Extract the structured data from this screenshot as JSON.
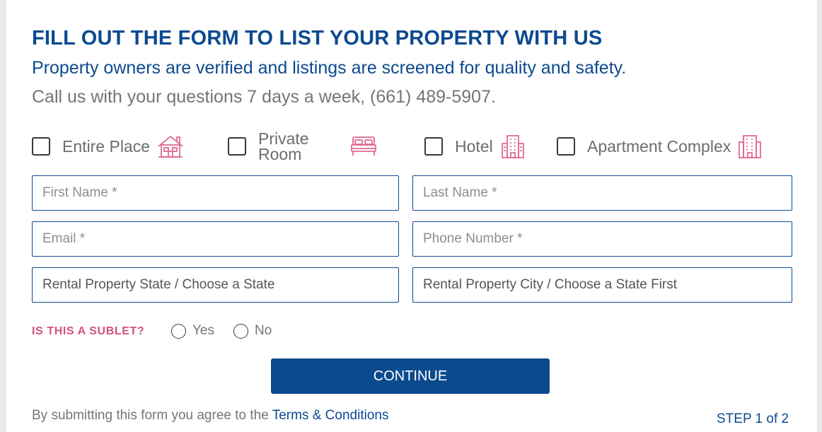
{
  "form": {
    "title": "FILL OUT THE FORM TO LIST YOUR PROPERTY WITH US",
    "subtitle": "Property owners are verified and listings are screened for quality and safety.",
    "call_text": "Call us with your questions 7 days a week, (661) 489-5907."
  },
  "property_types": [
    {
      "label": "Entire Place",
      "icon": "house-icon"
    },
    {
      "label": "Private Room",
      "icon": "bed-icon"
    },
    {
      "label": "Hotel",
      "icon": "hotel-icon"
    },
    {
      "label": "Apartment Complex",
      "icon": "apartment-building-icon"
    }
  ],
  "fields": {
    "first_name": {
      "placeholder": "First Name *",
      "value": ""
    },
    "last_name": {
      "placeholder": "Last Name *",
      "value": ""
    },
    "email": {
      "placeholder": "Email *",
      "value": ""
    },
    "phone": {
      "placeholder": "Phone Number *",
      "value": ""
    },
    "state": {
      "selected": "Rental Property State / Choose a State"
    },
    "city": {
      "selected": "Rental Property City / Choose a State First"
    }
  },
  "sublet": {
    "question": "IS THIS A SUBLET?",
    "options": [
      "Yes",
      "No"
    ]
  },
  "continue_label": "CONTINUE",
  "footer": {
    "agree_text": "By submitting this form you agree to the ",
    "terms_link": "Terms & Conditions",
    "step": "STEP 1 of 2"
  },
  "colors": {
    "brand_blue": "#0c4a8f",
    "accent_pink": "#d2527e",
    "icon_pink": "#e06a96"
  }
}
